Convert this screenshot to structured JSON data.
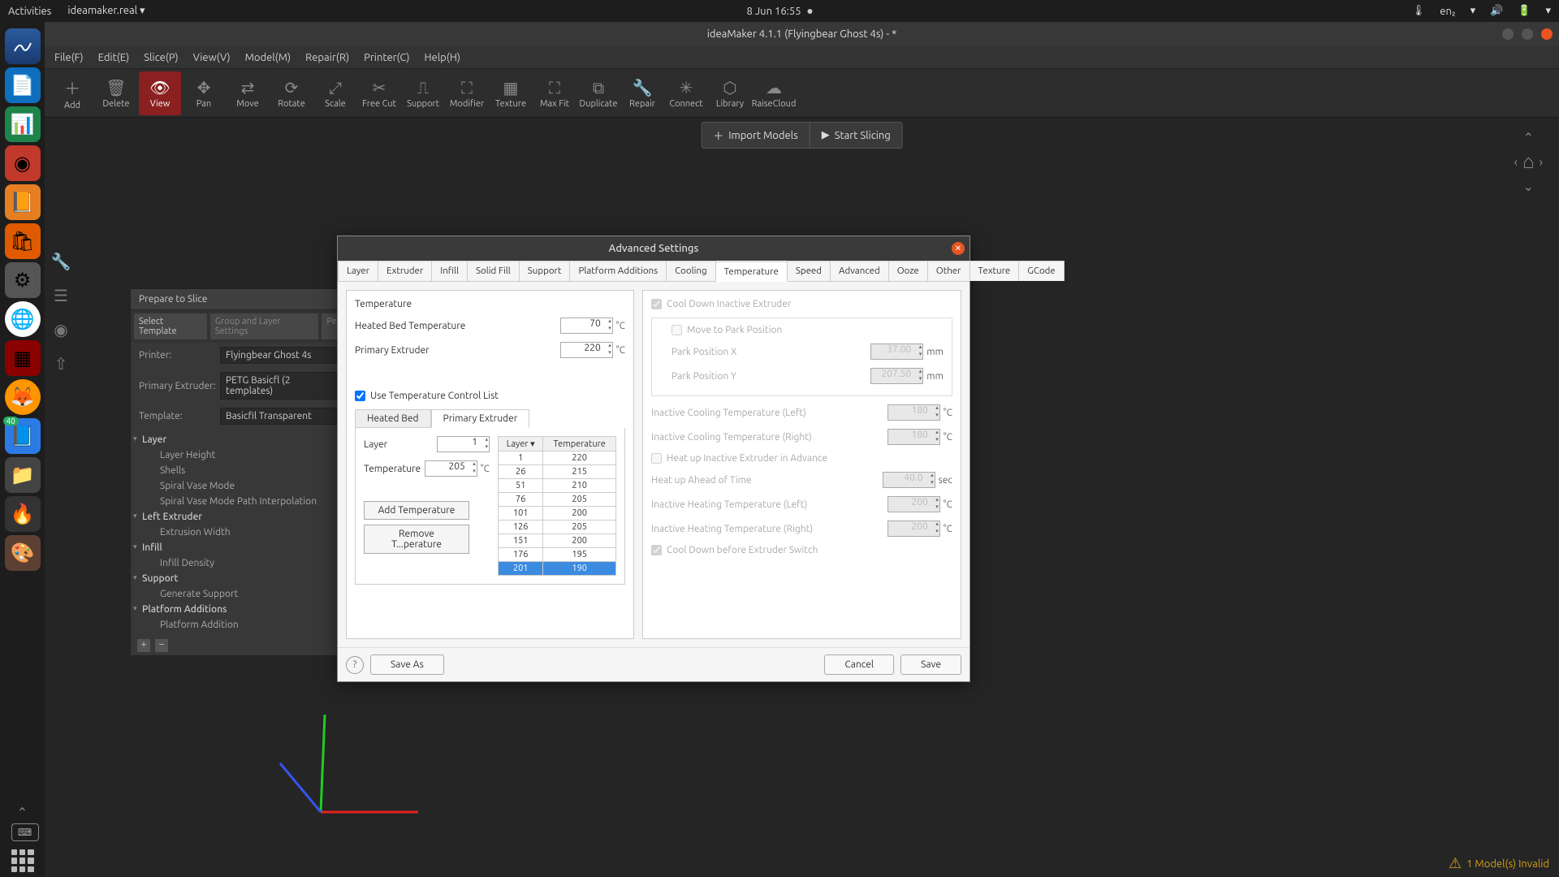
{
  "topbar": {
    "activities": "Activities",
    "appname": "ideamaker.real",
    "datetime": "8 Jun  16:55",
    "lang": "en₂"
  },
  "dock": {
    "badge": "40"
  },
  "window": {
    "title": "ideaMaker 4.1.1 (Flyingbear Ghost 4s) - *"
  },
  "menubar": [
    "File(F)",
    "Edit(E)",
    "Slice(P)",
    "View(V)",
    "Model(M)",
    "Repair(R)",
    "Printer(C)",
    "Help(H)"
  ],
  "toolbar": [
    "Add",
    "Delete",
    "View",
    "Pan",
    "Move",
    "Rotate",
    "Scale",
    "Free Cut",
    "Support",
    "Modifier",
    "Texture",
    "Max Fit",
    "Duplicate",
    "Repair",
    "Connect",
    "Library",
    "RaiseCloud"
  ],
  "actionbar": {
    "import": "Import Models",
    "slice": "Start Slicing"
  },
  "prepare": {
    "title": "Prepare to Slice",
    "tabs": [
      "Select Template",
      "Group and Layer Settings",
      "Per"
    ],
    "printer_label": "Printer:",
    "printer": "Flyingbear Ghost 4s",
    "extruder_label": "Primary Extruder:",
    "extruder": "PETG Basicfl (2 templates)",
    "template_label": "Template:",
    "template": "Basicfil Transparent",
    "tree": [
      {
        "h": "Layer"
      },
      {
        "s": "Layer Height"
      },
      {
        "s": "Shells"
      },
      {
        "s": "Spiral Vase Mode"
      },
      {
        "s": "Spiral Vase Mode Path Interpolation"
      },
      {
        "h": "Left Extruder"
      },
      {
        "s": "Extrusion Width"
      },
      {
        "h": "Infill"
      },
      {
        "s": "Infill Density"
      },
      {
        "h": "Support"
      },
      {
        "s": "Generate Support"
      },
      {
        "h": "Platform Additions"
      },
      {
        "s": "Platform Addition"
      }
    ]
  },
  "dialog": {
    "title": "Advanced Settings",
    "tabs": [
      "Layer",
      "Extruder",
      "Infill",
      "Solid Fill",
      "Support",
      "Platform Additions",
      "Cooling",
      "Temperature",
      "Speed",
      "Advanced",
      "Ooze",
      "Other",
      "Texture",
      "GCode"
    ],
    "active_tab": "Temperature",
    "section": "Temperature",
    "bed_label": "Heated Bed Temperature",
    "bed_val": "70",
    "ext_label": "Primary Extruder",
    "ext_val": "220",
    "degC": "°C",
    "use_list": "Use Temperature Control List",
    "subtabs": [
      "Heated Bed",
      "Primary Extruder"
    ],
    "layer_label": "Layer",
    "layer_val": "1",
    "temp_label": "Temperature",
    "temp_val": "205",
    "btn_add": "Add Temperature",
    "btn_remove": "Remove T...perature",
    "table_h1": "Layer",
    "table_h2": "Temperature",
    "table": [
      {
        "l": "1",
        "t": "220"
      },
      {
        "l": "26",
        "t": "215"
      },
      {
        "l": "51",
        "t": "210"
      },
      {
        "l": "76",
        "t": "205"
      },
      {
        "l": "101",
        "t": "200"
      },
      {
        "l": "126",
        "t": "205"
      },
      {
        "l": "151",
        "t": "200"
      },
      {
        "l": "176",
        "t": "195"
      },
      {
        "l": "201",
        "t": "190"
      }
    ],
    "cool_inactive": "Cool Down Inactive Extruder",
    "move_park": "Move to Park Position",
    "park_x": "Park Position X",
    "park_x_v": "37.00",
    "park_y": "Park Position Y",
    "park_y_v": "207.50",
    "mm": "mm",
    "cool_left": "Inactive Cooling Temperature (Left)",
    "cool_left_v": "180",
    "cool_right": "Inactive Cooling Temperature (Right)",
    "cool_right_v": "180",
    "heat_adv": "Heat up Inactive Extruder in Advance",
    "heat_ahead": "Heat up Ahead of Time",
    "heat_ahead_v": "40.0",
    "sec": "sec",
    "heat_left": "Inactive Heating Temperature (Left)",
    "heat_left_v": "200",
    "heat_right": "Inactive Heating Temperature (Right)",
    "heat_right_v": "200",
    "cool_switch": "Cool Down before Extruder Switch",
    "save_as": "Save As",
    "cancel": "Cancel",
    "save": "Save"
  },
  "status": {
    "text": "1 Model(s) Invalid"
  }
}
